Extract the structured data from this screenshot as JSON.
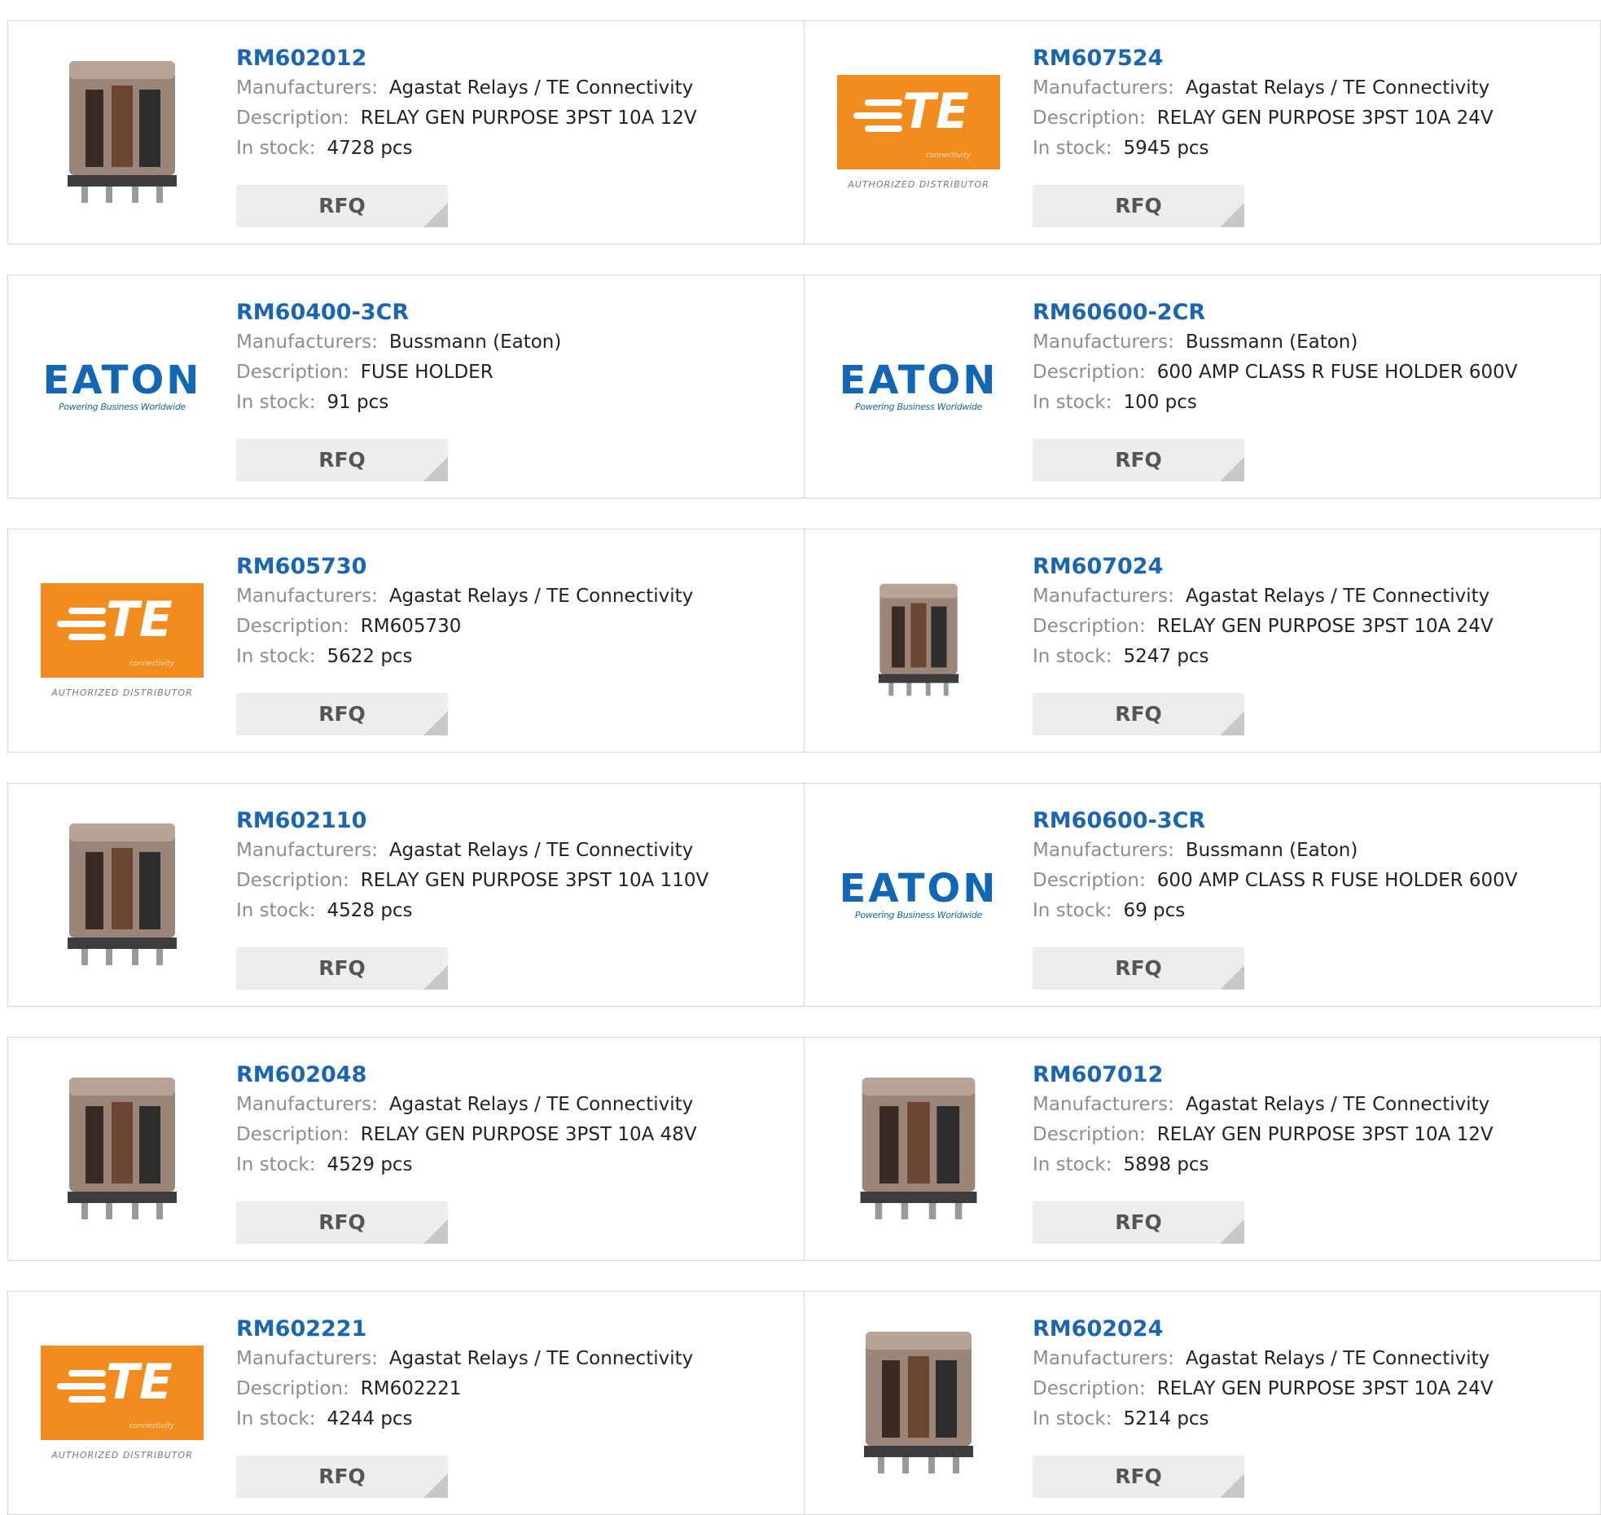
{
  "labels": {
    "manufacturers": "Manufacturers:",
    "description": "Description:",
    "in_stock": "In stock:",
    "rfq": "RFQ"
  },
  "logos": {
    "te_text": "TE",
    "te_connectivity": "connectivity",
    "te_authorized": "AUTHORIZED DISTRIBUTOR",
    "eaton_text": "EATON",
    "eaton_tagline": "Powering Business Worldwide"
  },
  "colors": {
    "part_link": "#1a66b3",
    "te_orange": "#f28c1e",
    "eaton_blue": "#1166b6"
  },
  "products": [
    {
      "part": "RM602012",
      "manufacturer": "Agastat Relays / TE Connectivity",
      "description": "RELAY GEN PURPOSE 3PST 10A 12V",
      "stock": "4728 pcs",
      "image": "relay-photo"
    },
    {
      "part": "RM607524",
      "manufacturer": "Agastat Relays / TE Connectivity",
      "description": "RELAY GEN PURPOSE 3PST 10A 24V",
      "stock": "5945 pcs",
      "image": "te-logo"
    },
    {
      "part": "RM60400-3CR",
      "manufacturer": "Bussmann (Eaton)",
      "description": "FUSE HOLDER",
      "stock": "91 pcs",
      "image": "eaton-logo"
    },
    {
      "part": "RM60600-2CR",
      "manufacturer": "Bussmann (Eaton)",
      "description": "600 AMP CLASS R FUSE HOLDER 600V",
      "stock": "100 pcs",
      "image": "eaton-logo"
    },
    {
      "part": "RM605730",
      "manufacturer": "Agastat Relays / TE Connectivity",
      "description": "RM605730",
      "stock": "5622 pcs",
      "image": "te-logo"
    },
    {
      "part": "RM607024",
      "manufacturer": "Agastat Relays / TE Connectivity",
      "description": "RELAY GEN PURPOSE 3PST 10A 24V",
      "stock": "5247 pcs",
      "image": "relay-photo-small"
    },
    {
      "part": "RM602110",
      "manufacturer": "Agastat Relays / TE Connectivity",
      "description": "RELAY GEN PURPOSE 3PST 10A 110V",
      "stock": "4528 pcs",
      "image": "relay-photo"
    },
    {
      "part": "RM60600-3CR",
      "manufacturer": "Bussmann (Eaton)",
      "description": "600 AMP CLASS R FUSE HOLDER 600V",
      "stock": "69 pcs",
      "image": "eaton-logo"
    },
    {
      "part": "RM602048",
      "manufacturer": "Agastat Relays / TE Connectivity",
      "description": "RELAY GEN PURPOSE 3PST 10A 48V",
      "stock": "4529 pcs",
      "image": "relay-photo"
    },
    {
      "part": "RM607012",
      "manufacturer": "Agastat Relays / TE Connectivity",
      "description": "RELAY GEN PURPOSE 3PST 10A 12V",
      "stock": "5898 pcs",
      "image": "relay-photo-wide"
    },
    {
      "part": "RM602221",
      "manufacturer": "Agastat Relays / TE Connectivity",
      "description": "RM602221",
      "stock": "4244 pcs",
      "image": "te-logo"
    },
    {
      "part": "RM602024",
      "manufacturer": "Agastat Relays / TE Connectivity",
      "description": "RELAY GEN PURPOSE 3PST 10A 24V",
      "stock": "5214 pcs",
      "image": "relay-photo"
    }
  ]
}
